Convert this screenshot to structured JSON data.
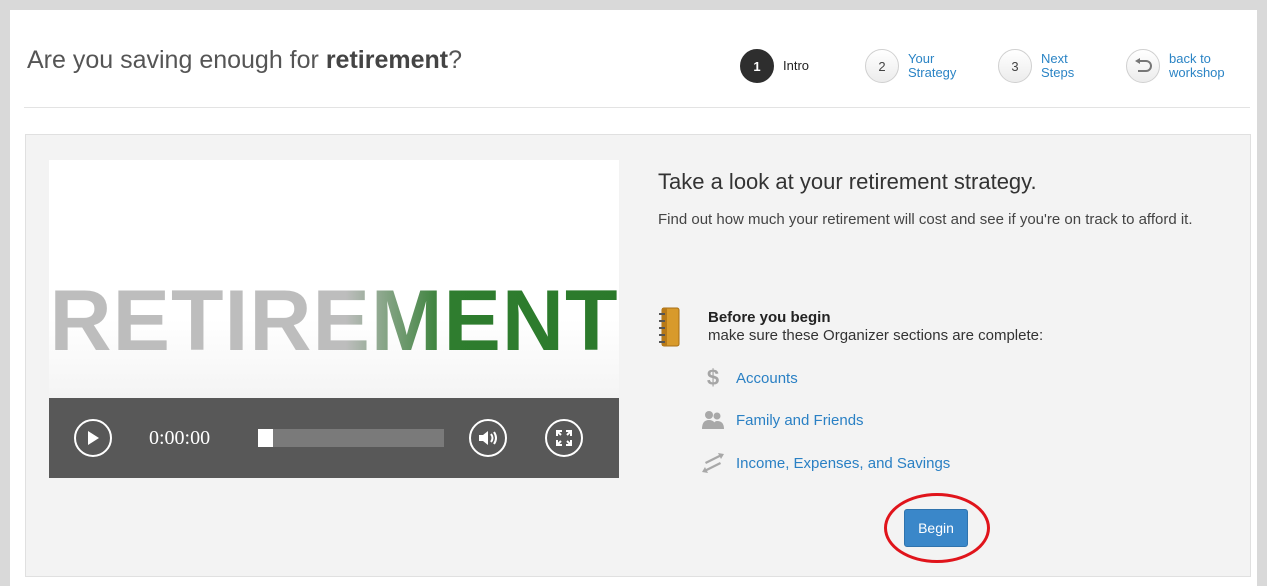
{
  "header": {
    "title_prefix": "Are you saving enough for ",
    "title_bold": "retirement",
    "title_suffix": "?"
  },
  "steps": [
    {
      "number": "1",
      "label": "Intro",
      "active": true
    },
    {
      "number": "2",
      "label": "Your Strategy",
      "active": false
    },
    {
      "number": "3",
      "label": "Next Steps",
      "active": false
    }
  ],
  "back": {
    "label": "back to workshop",
    "icon": "back-arrow-icon"
  },
  "video": {
    "title_text": "RETIREMENT",
    "time": "0:00:00",
    "progress": 0.08,
    "controls": [
      "play-icon",
      "volume-icon",
      "fullscreen-icon"
    ]
  },
  "intro": {
    "heading": "Take a look at your retirement strategy.",
    "description": "Find out how much your retirement will cost and see if you're on track to afford it."
  },
  "before_you_begin": {
    "title": "Before you begin",
    "subtitle": "make sure these Organizer sections are complete:",
    "icon": "notebook-icon",
    "links": [
      {
        "label": "Accounts",
        "icon": "dollar-icon"
      },
      {
        "label": "Family and Friends",
        "icon": "people-icon"
      },
      {
        "label": "Income, Expenses, and Savings",
        "icon": "transfer-icon"
      }
    ]
  },
  "begin_button": {
    "label": "Begin"
  },
  "colors": {
    "accent": "#2b84c5",
    "button": "#3a87c9",
    "highlight": "#e0141b",
    "video_green": "#2f7d2f"
  }
}
